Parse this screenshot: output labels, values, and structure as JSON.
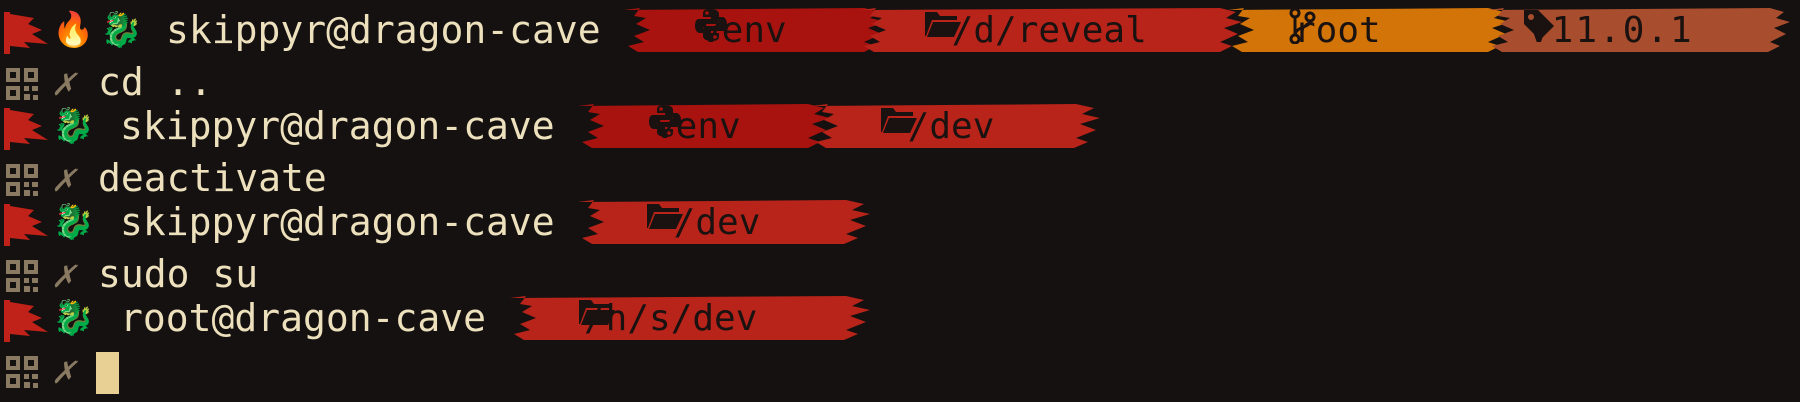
{
  "terminal": {
    "prompts": [
      {
        "fire_emoji": "🔥",
        "dragon_emoji": "🐉",
        "user_host": "skippyr@dragon-cave",
        "segments": [
          {
            "icon": "python-icon",
            "label": "venv",
            "color": "#a9130f"
          },
          {
            "icon": "folder-icon",
            "label": "~/d/reveal",
            "color": "#b8231a"
          },
          {
            "icon": "git-branch-icon",
            "label": "root",
            "color": "#d27408"
          },
          {
            "icon": "tag-icon",
            "label": "v11.0.1",
            "color": "#a84d2d"
          }
        ]
      },
      {
        "dragon_emoji": "🐉",
        "user_host": "skippyr@dragon-cave",
        "segments": [
          {
            "icon": "python-icon",
            "label": "venv",
            "color": "#a9130f"
          },
          {
            "icon": "folder-icon",
            "label": "~/dev",
            "color": "#b8231a"
          }
        ]
      },
      {
        "dragon_emoji": "🐉",
        "user_host": "skippyr@dragon-cave",
        "segments": [
          {
            "icon": "folder-icon",
            "label": "~/dev",
            "color": "#b8231a"
          }
        ]
      },
      {
        "dragon_emoji": "🐉",
        "user_host": "root@dragon-cave",
        "segments": [
          {
            "icon": "folder-icon",
            "label": "/h/s/dev",
            "color": "#b8231a"
          }
        ]
      }
    ],
    "commands": [
      {
        "status_symbol": "✗",
        "text": "cd .."
      },
      {
        "status_symbol": "✗",
        "text": "deactivate"
      },
      {
        "status_symbol": "✗",
        "text": "sudo su"
      },
      {
        "status_symbol": "✗",
        "text": ""
      }
    ],
    "colors": {
      "background": "#141110",
      "text": "#ede0bd",
      "flag_red": "#c0221a",
      "cursor": "#e8cf94",
      "status_symbol": "#8a7a62"
    }
  }
}
